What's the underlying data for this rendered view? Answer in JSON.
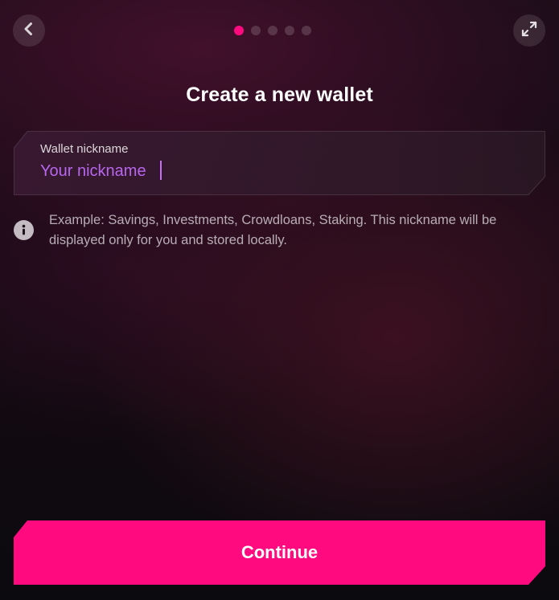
{
  "header": {
    "back_icon": "chevron-left-icon",
    "expand_icon": "expand-arrows-icon",
    "steps_total": 5,
    "step_current": 1
  },
  "title": "Create a new wallet",
  "nickname_field": {
    "label": "Wallet nickname",
    "placeholder": "Your nickname",
    "value": ""
  },
  "info": {
    "icon": "info-icon",
    "text": "Example: Savings, Investments, Crowdloans, Staking. This nickname will be displayed only for you and stored locally."
  },
  "continue_button": {
    "label": "Continue"
  },
  "colors": {
    "accent": "#ff0a7f",
    "placeholder": "#c86cf5",
    "dot_inactive": "#3a2a36"
  }
}
